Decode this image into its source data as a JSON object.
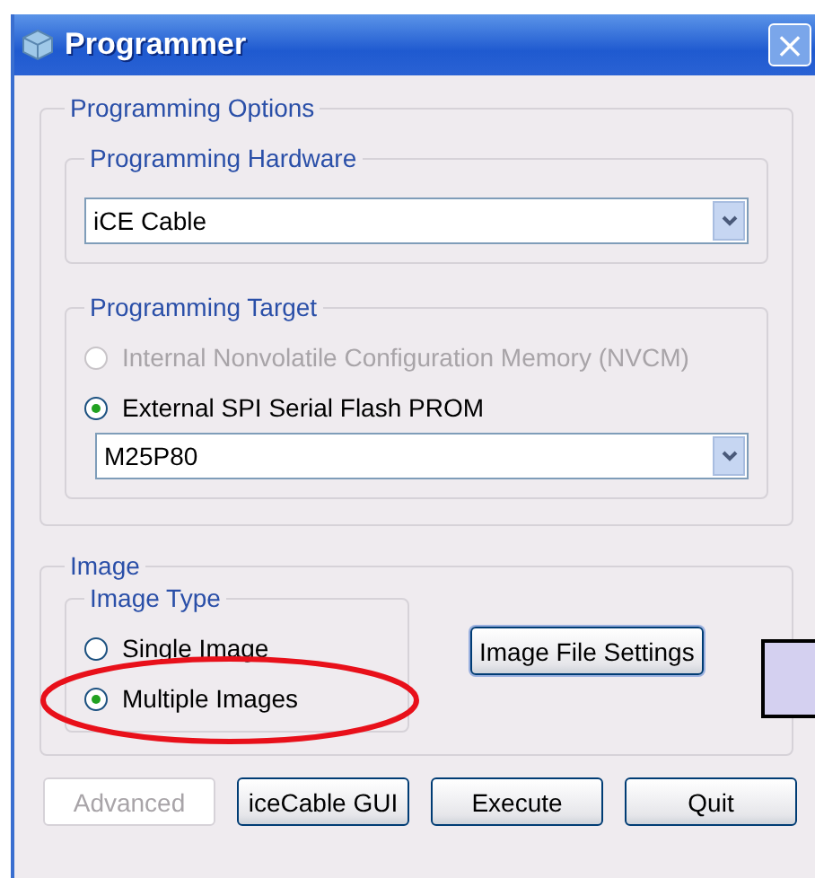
{
  "window": {
    "title": "Programmer",
    "close": "×"
  },
  "programming_options": {
    "title": "Programming Options",
    "hardware": {
      "title": "Programming Hardware",
      "value": "iCE Cable"
    },
    "target": {
      "title": "Programming Target",
      "options": [
        {
          "label": "Internal Nonvolatile Configuration Memory (NVCM)",
          "selected": false,
          "disabled": true
        },
        {
          "label": "External SPI Serial Flash PROM",
          "selected": true,
          "disabled": false
        }
      ],
      "device": "M25P80"
    }
  },
  "image": {
    "title": "Image",
    "type": {
      "title": "Image Type",
      "options": [
        {
          "label": "Single Image",
          "selected": false,
          "disabled": false
        },
        {
          "label": "Multiple Images",
          "selected": true,
          "disabled": false
        }
      ]
    },
    "settings_button": "Image File Settings"
  },
  "buttons": [
    {
      "label": "Advanced",
      "disabled": true
    },
    {
      "label": "iceCable GUI",
      "disabled": false
    },
    {
      "label": "Execute",
      "disabled": false
    },
    {
      "label": "Quit",
      "disabled": false
    }
  ]
}
